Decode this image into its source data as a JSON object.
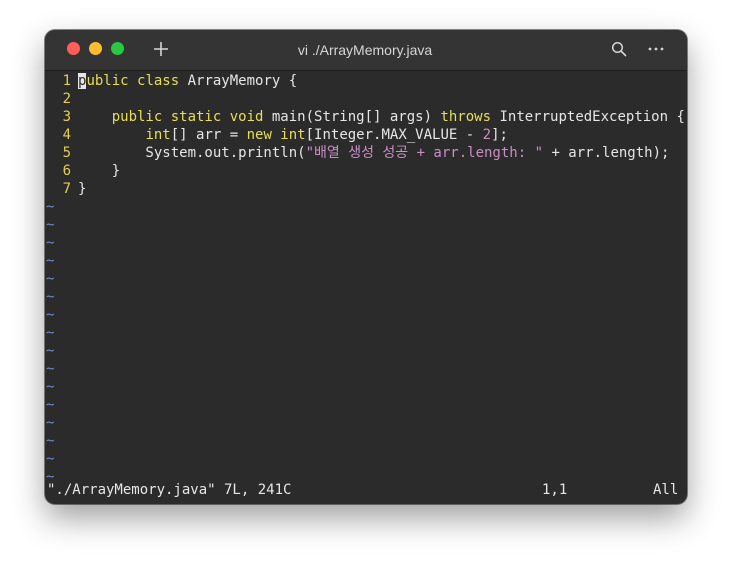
{
  "window": {
    "title": "vi ./ArrayMemory.java",
    "controls": [
      "close",
      "minimize",
      "zoom"
    ],
    "buttons": {
      "new_tab": "plus-icon",
      "search": "search-icon",
      "more": "more-icon"
    }
  },
  "editor": {
    "lines": [
      {
        "number": "1",
        "tokens": [
          {
            "cls": "cursor",
            "text": "p"
          },
          {
            "cls": "kw",
            "text": "ublic class"
          },
          {
            "cls": "",
            "text": " ArrayMemory {"
          }
        ]
      },
      {
        "number": "2",
        "tokens": []
      },
      {
        "number": "3",
        "tokens": [
          {
            "cls": "",
            "text": "    "
          },
          {
            "cls": "kw",
            "text": "public static void"
          },
          {
            "cls": "",
            "text": " main(String[] args) "
          },
          {
            "cls": "kw",
            "text": "throws"
          },
          {
            "cls": "",
            "text": " InterruptedException {"
          }
        ]
      },
      {
        "number": "4",
        "tokens": [
          {
            "cls": "",
            "text": "        "
          },
          {
            "cls": "kw",
            "text": "int"
          },
          {
            "cls": "",
            "text": "[] arr = "
          },
          {
            "cls": "kw",
            "text": "new int"
          },
          {
            "cls": "",
            "text": "[Integer.MAX_VALUE - "
          },
          {
            "cls": "num",
            "text": "2"
          },
          {
            "cls": "",
            "text": "];"
          }
        ]
      },
      {
        "number": "5",
        "tokens": [
          {
            "cls": "",
            "text": "        System.out.println("
          },
          {
            "cls": "str",
            "text": "\"배열 생성 성공 + arr.length: \""
          },
          {
            "cls": "",
            "text": " + arr.length);"
          }
        ]
      },
      {
        "number": "6",
        "tokens": [
          {
            "cls": "",
            "text": "    }"
          }
        ]
      },
      {
        "number": "7",
        "tokens": [
          {
            "cls": "",
            "text": "}"
          }
        ]
      }
    ],
    "empty_line_marker": "~",
    "empty_line_count": 16
  },
  "status": {
    "file": "\"./ArrayMemory.java\" 7L, 241C",
    "position": "1,1",
    "scroll": "All"
  },
  "colors": {
    "background": "#2b2b2b",
    "titlebar": "#343434",
    "line_number": "#e5d04a",
    "keyword": "#e8df55",
    "string": "#c98ec4",
    "tilde": "#6c8bd4",
    "text": "#e6e6e6"
  }
}
